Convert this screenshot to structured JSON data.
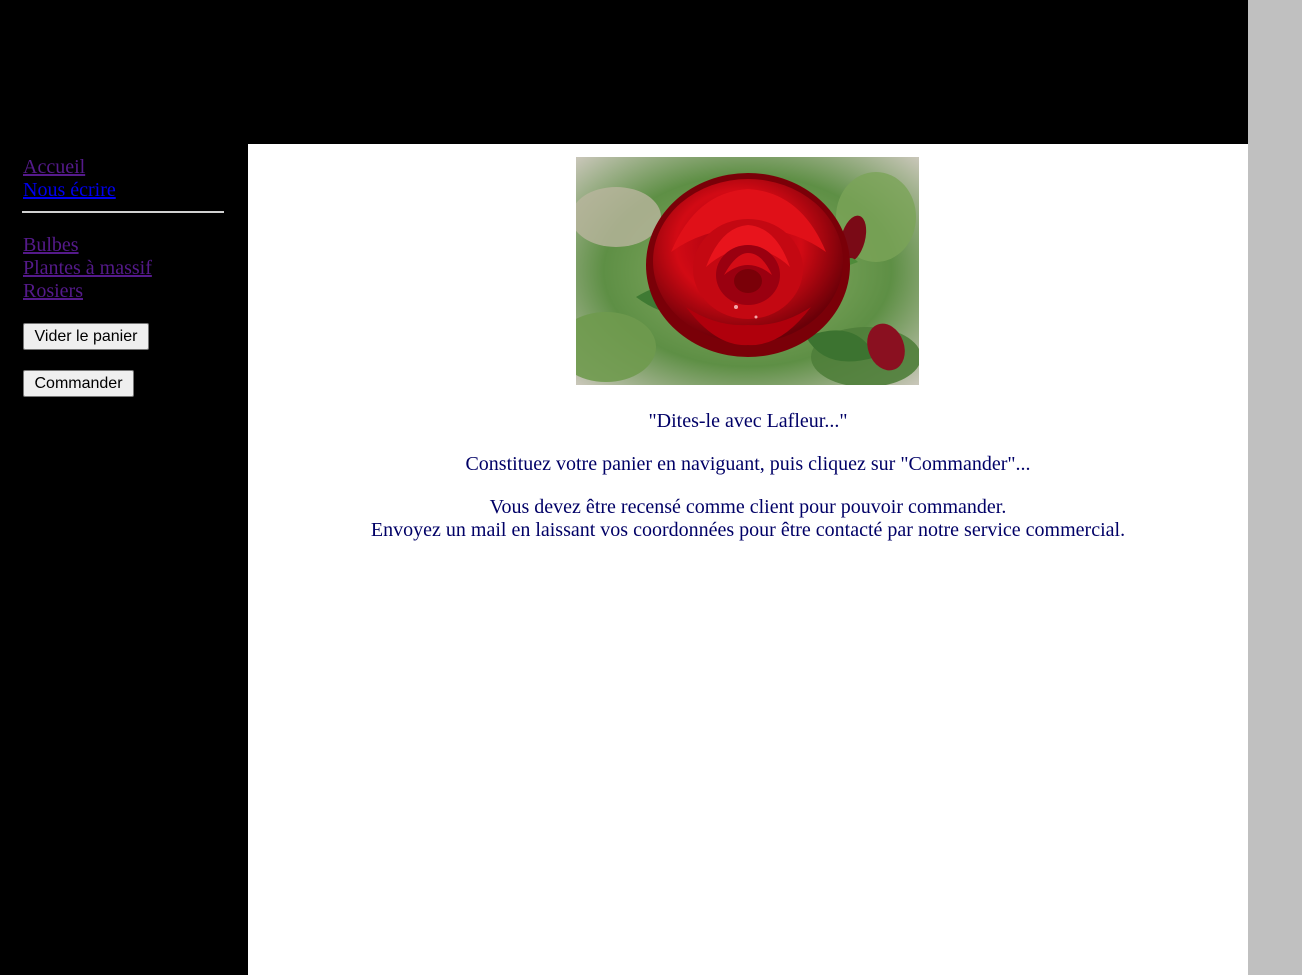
{
  "sidebar": {
    "nav_links": [
      {
        "label": "Accueil",
        "state": "visited"
      },
      {
        "label": "Nous écrire",
        "state": "unvisited"
      }
    ],
    "category_links": [
      {
        "label": "Bulbes",
        "state": "visited"
      },
      {
        "label": "Plantes à massif",
        "state": "visited"
      },
      {
        "label": "Rosiers",
        "state": "visited"
      }
    ],
    "empty_cart_label": "Vider le panier",
    "order_label": "Commander"
  },
  "main": {
    "hero_image": "red-rose-photo",
    "slogan": "\"Dites-le avec Lafleur...\"",
    "instructions": "Constituez votre panier en naviguant, puis cliquez sur \"Commander\"...",
    "client_line_1": "Vous devez être recensé comme client pour pouvoir commander.",
    "client_line_2": "Envoyez un mail en laissant vos coordonnées pour être contacté par notre service commercial."
  },
  "colors": {
    "page_background": "#000000",
    "scroll_gutter": "#c0c0c0",
    "content_background": "#ffffff",
    "content_text": "#000066",
    "link_visited": "#551a8b",
    "link_unvisited": "#0000ee"
  }
}
